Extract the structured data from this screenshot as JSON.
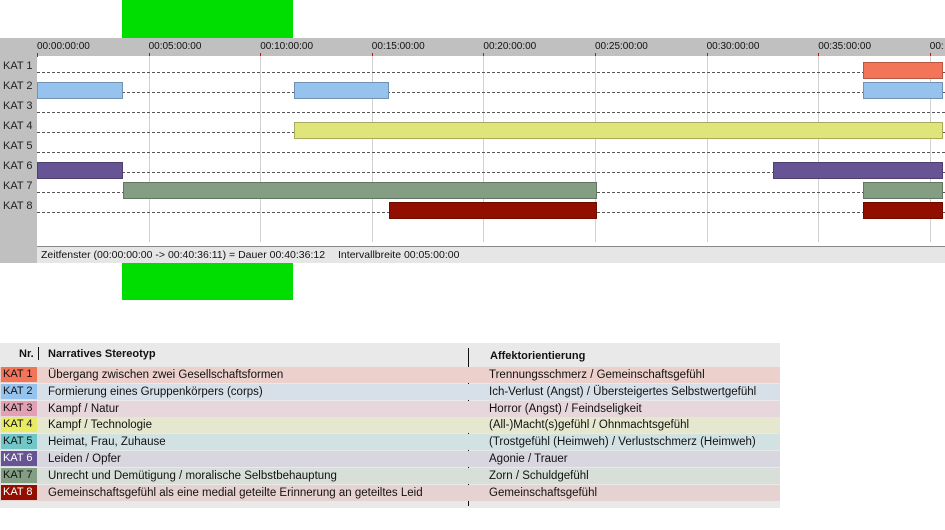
{
  "timeline": {
    "total_seconds": 2436,
    "tick_labels": [
      "00:00:00:00",
      "00:05:00:00",
      "00:10:00:00",
      "00:15:00:00",
      "00:20:00:00",
      "00:25:00:00",
      "00:30:00:00",
      "00:35:00:00",
      "00:"
    ],
    "tick_seconds": [
      0,
      300,
      600,
      900,
      1200,
      1500,
      1800,
      2100,
      2400
    ],
    "rows": [
      {
        "label": "KAT 1",
        "color": "#f2755a",
        "segments": [
          [
            2220,
            2436
          ]
        ]
      },
      {
        "label": "KAT 2",
        "color": "#96c2ee",
        "segments": [
          [
            0,
            230
          ],
          [
            690,
            945
          ],
          [
            2220,
            2436
          ]
        ]
      },
      {
        "label": "KAT 3",
        "color": "#e3a0b4",
        "segments": []
      },
      {
        "label": "KAT 4",
        "color": "#dfe57a",
        "segments": [
          [
            690,
            2436
          ]
        ]
      },
      {
        "label": "KAT 5",
        "color": "#72c6c8",
        "segments": []
      },
      {
        "label": "KAT 6",
        "color": "#675494",
        "segments": [
          [
            0,
            230
          ],
          [
            1978,
            2436
          ]
        ]
      },
      {
        "label": "KAT 7",
        "color": "#839e83",
        "segments": [
          [
            230,
            1505
          ],
          [
            2220,
            2436
          ]
        ]
      },
      {
        "label": "KAT 8",
        "color": "#920f00",
        "segments": [
          [
            945,
            1505
          ],
          [
            2220,
            2436
          ]
        ]
      }
    ],
    "status": {
      "zeitfenster": "Zeitfenster (00:00:00:00 -> 00:40:36:11) = Dauer 00:40:36:12",
      "intervall": "Intervallbreite 00:05:00:00"
    }
  },
  "legend": {
    "headers": {
      "nr": "Nr.",
      "stereotyp": "Narratives Stereotyp",
      "affekt": "Affektorientierung"
    },
    "rows": [
      {
        "badge": "KAT 1",
        "color": "#f2755a",
        "bg": "#ebd0cb",
        "text_color": "#111",
        "stereotyp": "Übergang zwischen zwei Gesellschaftsformen",
        "affekt": "Trennungsschmerz / Gemeinschaftsgefühl"
      },
      {
        "badge": "KAT 2",
        "color": "#96c2ee",
        "bg": "#d7dfe8",
        "text_color": "#111",
        "stereotyp": "Formierung eines Gruppenkörpers (corps)",
        "affekt": "Ich-Verlust (Angst) / Übersteigertes Selbstwertgefühl"
      },
      {
        "badge": "KAT 3",
        "color": "#e3a0b4",
        "bg": "#e7d6dc",
        "text_color": "#111",
        "stereotyp": "Kampf / Natur",
        "affekt": "Horror (Angst) / Feindseligkeit"
      },
      {
        "badge": "KAT 4",
        "color": "#e9ec62",
        "bg": "#e6e7cf",
        "text_color": "#111",
        "stereotyp": "Kampf / Technologie",
        "affekt": "(All-)Macht(s)gefühl / Ohnmachtsgefühl"
      },
      {
        "badge": "KAT 5",
        "color": "#72c6c8",
        "bg": "#d2e2e2",
        "text_color": "#111",
        "stereotyp": "Heimat, Frau, Zuhause",
        "affekt": "(Trostgefühl (Heimweh) / Verlustschmerz (Heimweh)"
      },
      {
        "badge": "KAT 6",
        "color": "#675494",
        "bg": "#d8d6df",
        "text_color": "#ffffff",
        "stereotyp": "Leiden / Opfer",
        "affekt": "Agonie / Trauer"
      },
      {
        "badge": "KAT 7",
        "color": "#839e83",
        "bg": "#d8dfd8",
        "text_color": "#111",
        "stereotyp": "Unrecht und Demütigung / moralische Selbstbehauptung",
        "affekt": "Zorn / Schuldgefühl"
      },
      {
        "badge": "KAT 8",
        "color": "#920f00",
        "bg": "#e6d2d0",
        "text_color": "#ffffff",
        "stereotyp": "Gemeinschaftsgefühl als eine medial geteilte Erinnerung an geteiltes Leid",
        "affekt": "Gemeinschaftsgefühl"
      }
    ]
  }
}
